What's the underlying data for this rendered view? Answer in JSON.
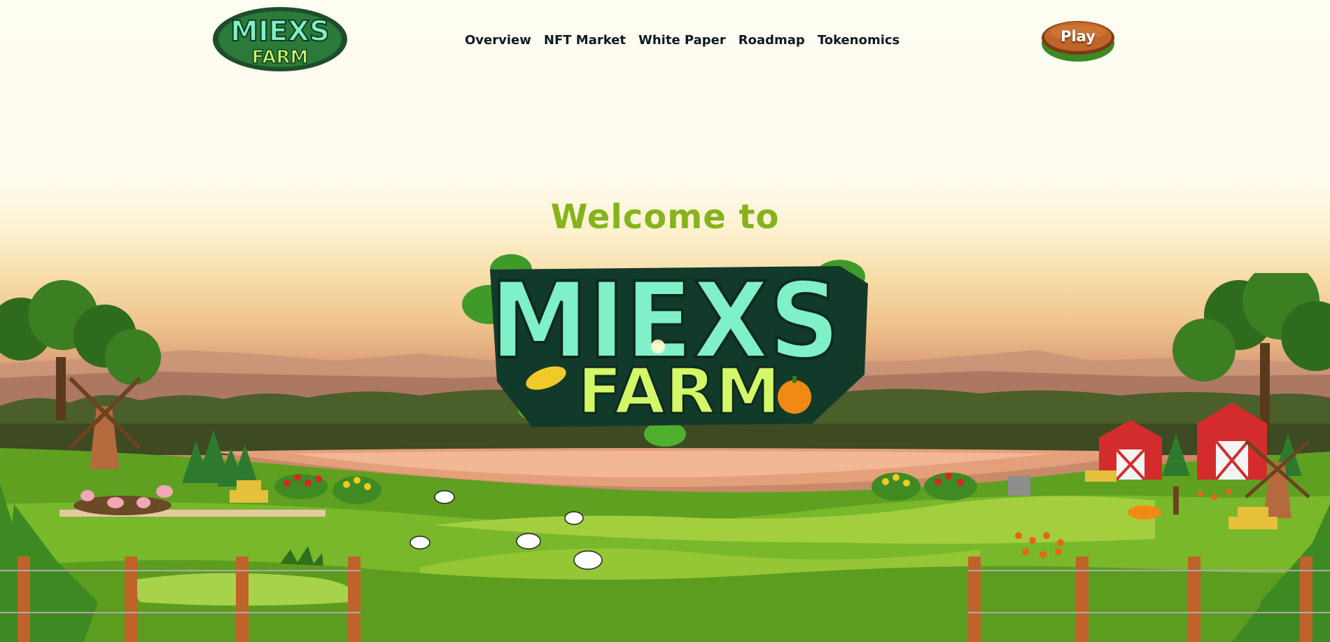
{
  "header": {
    "logo_text": [
      "MIEXS",
      "FARM"
    ],
    "nav": [
      {
        "label": "Overview"
      },
      {
        "label": "NFT Market"
      },
      {
        "label": "White Paper"
      },
      {
        "label": "Roadmap"
      },
      {
        "label": "Tokenomics"
      }
    ],
    "play_label": "Play"
  },
  "hero": {
    "welcome": "Welcome to",
    "logo_text": [
      "MIEXS",
      "FARM"
    ]
  },
  "colors": {
    "welcome": "#86b31c",
    "nav_text": "#0d1b20",
    "play_button": "#c0652a",
    "logo_green": "#7ff0c8"
  }
}
